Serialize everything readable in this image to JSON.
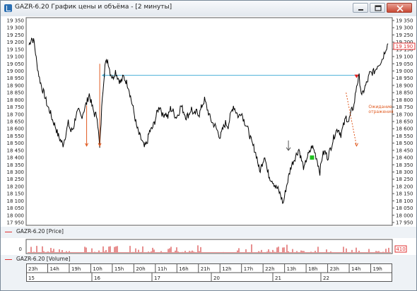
{
  "window": {
    "title": "GAZR-6.20 График цены и объёма - [2 минуты]",
    "controls": [
      "minimize",
      "restore",
      "close"
    ]
  },
  "price_panel": {
    "y_ticks": [
      "19 350",
      "19 300",
      "19 250",
      "19 200",
      "19 150",
      "19 100",
      "19 050",
      "19 000",
      "18 950",
      "18 900",
      "18 850",
      "18 800",
      "18 750",
      "18 700",
      "18 650",
      "18 600",
      "18 550",
      "18 500",
      "18 450",
      "18 400",
      "18 350",
      "18 300",
      "18 250",
      "18 200",
      "18 150",
      "18 100",
      "18 050",
      "18 000",
      "17 950"
    ],
    "current_price": "19 190",
    "annotation": "Ожидание отражения",
    "legend": "GAZR-6.20 [Price]"
  },
  "volume_panel": {
    "y_tick": "0",
    "current_volume": "410",
    "legend": "GAZR-6.20 [Volume]"
  },
  "time_axis": {
    "hours": [
      "23h",
      "14h",
      "19h",
      "10h",
      "15h",
      "20h",
      "11h",
      "16h",
      "21h",
      "12h",
      "17h",
      "22h",
      "13h",
      "18h",
      "23h",
      "14h",
      "19h"
    ],
    "days": [
      "15",
      "16",
      "17",
      "20",
      "21",
      "22"
    ]
  },
  "colors": {
    "price_line": "#000000",
    "level_line": "#4ab0d8",
    "arrow": "#e05a20",
    "sell_marker": "#e02020",
    "buy_marker": "#20c020",
    "volume": "#d02020"
  },
  "chart_data": {
    "type": "line",
    "series": [
      {
        "points": [
          [
            0,
            19180
          ],
          [
            1,
            19230
          ],
          [
            2,
            19200
          ],
          [
            3,
            19050
          ],
          [
            4,
            18950
          ],
          [
            5,
            18880
          ],
          [
            6,
            18830
          ],
          [
            7,
            18760
          ],
          [
            8,
            18720
          ],
          [
            9,
            18660
          ],
          [
            10,
            18620
          ],
          [
            11,
            18560
          ],
          [
            12,
            18520
          ],
          [
            13,
            18490
          ],
          [
            14,
            18560
          ],
          [
            15,
            18640
          ],
          [
            16,
            18580
          ],
          [
            17,
            18610
          ],
          [
            18,
            18700
          ],
          [
            19,
            18720
          ],
          [
            20,
            18680
          ],
          [
            21,
            18730
          ],
          [
            22,
            18780
          ],
          [
            23,
            18840
          ],
          [
            24,
            18760
          ],
          [
            25,
            18700
          ],
          [
            26,
            18690
          ],
          [
            27,
            18460
          ],
          [
            28,
            18830
          ],
          [
            29,
            19040
          ],
          [
            30,
            19080
          ],
          [
            31,
            18990
          ],
          [
            32,
            18950
          ],
          [
            33,
            19000
          ],
          [
            34,
            18950
          ],
          [
            35,
            18920
          ],
          [
            36,
            18960
          ],
          [
            37,
            18930
          ],
          [
            38,
            18890
          ],
          [
            39,
            18800
          ],
          [
            40,
            18720
          ],
          [
            41,
            18620
          ],
          [
            42,
            18560
          ],
          [
            43,
            18520
          ],
          [
            44,
            18470
          ],
          [
            45,
            18500
          ],
          [
            46,
            18580
          ],
          [
            47,
            18600
          ],
          [
            48,
            18650
          ],
          [
            49,
            18720
          ],
          [
            50,
            18760
          ],
          [
            51,
            18690
          ],
          [
            52,
            18710
          ],
          [
            53,
            18680
          ],
          [
            54,
            18740
          ],
          [
            55,
            18720
          ],
          [
            56,
            18680
          ],
          [
            57,
            18700
          ],
          [
            58,
            18760
          ],
          [
            59,
            18720
          ],
          [
            60,
            18680
          ],
          [
            61,
            18700
          ],
          [
            62,
            18740
          ],
          [
            63,
            18690
          ],
          [
            64,
            18720
          ],
          [
            65,
            18700
          ],
          [
            66,
            18760
          ],
          [
            67,
            18800
          ],
          [
            68,
            18740
          ],
          [
            69,
            18680
          ],
          [
            70,
            18640
          ],
          [
            71,
            18620
          ],
          [
            72,
            18580
          ],
          [
            73,
            18540
          ],
          [
            74,
            18600
          ],
          [
            75,
            18640
          ],
          [
            76,
            18620
          ],
          [
            77,
            18700
          ],
          [
            78,
            18760
          ],
          [
            79,
            18720
          ],
          [
            80,
            18680
          ],
          [
            81,
            18720
          ],
          [
            82,
            18660
          ],
          [
            83,
            18620
          ],
          [
            84,
            18570
          ],
          [
            85,
            18500
          ],
          [
            86,
            18460
          ],
          [
            87,
            18400
          ],
          [
            88,
            18300
          ],
          [
            89,
            18360
          ],
          [
            90,
            18420
          ],
          [
            91,
            18300
          ],
          [
            92,
            18260
          ],
          [
            93,
            18240
          ],
          [
            94,
            18200
          ],
          [
            95,
            18180
          ],
          [
            96,
            18140
          ],
          [
            97,
            18080
          ],
          [
            98,
            18180
          ],
          [
            99,
            18260
          ],
          [
            100,
            18340
          ],
          [
            101,
            18380
          ],
          [
            102,
            18420
          ],
          [
            103,
            18460
          ],
          [
            104,
            18380
          ],
          [
            105,
            18320
          ],
          [
            106,
            18400
          ],
          [
            107,
            18430
          ],
          [
            108,
            18480
          ],
          [
            109,
            18440
          ],
          [
            110,
            18380
          ],
          [
            111,
            18300
          ],
          [
            112,
            18420
          ],
          [
            113,
            18440
          ],
          [
            114,
            18400
          ],
          [
            115,
            18460
          ],
          [
            116,
            18520
          ],
          [
            117,
            18580
          ],
          [
            118,
            18600
          ],
          [
            119,
            18560
          ],
          [
            120,
            18620
          ],
          [
            121,
            18680
          ],
          [
            122,
            18650
          ],
          [
            123,
            18720
          ],
          [
            124,
            18760
          ],
          [
            125,
            18900
          ],
          [
            126,
            18960
          ],
          [
            127,
            18820
          ],
          [
            128,
            18880
          ],
          [
            129,
            18920
          ],
          [
            130,
            18980
          ],
          [
            131,
            18990
          ],
          [
            132,
            19000
          ],
          [
            133,
            19040
          ],
          [
            134,
            19060
          ],
          [
            135,
            19090
          ],
          [
            136,
            19150
          ],
          [
            137,
            19190
          ]
        ],
        "note_ticks": "x is bar index over the session"
      }
    ],
    "ylim": [
      17950,
      19350
    ],
    "level_line_price": 18970,
    "arrows": [
      {
        "from": [
          22,
          18760
        ],
        "to": [
          22,
          18480
        ]
      },
      {
        "from": [
          27,
          19050
        ],
        "to": [
          27,
          18480
        ]
      },
      {
        "from": [
          121,
          18850
        ],
        "to": [
          125,
          18480
        ]
      }
    ],
    "markers": [
      {
        "type": "sell",
        "x": 125,
        "y": 18960
      },
      {
        "type": "buy",
        "x": 108,
        "y": 18400
      }
    ],
    "grid": false
  }
}
